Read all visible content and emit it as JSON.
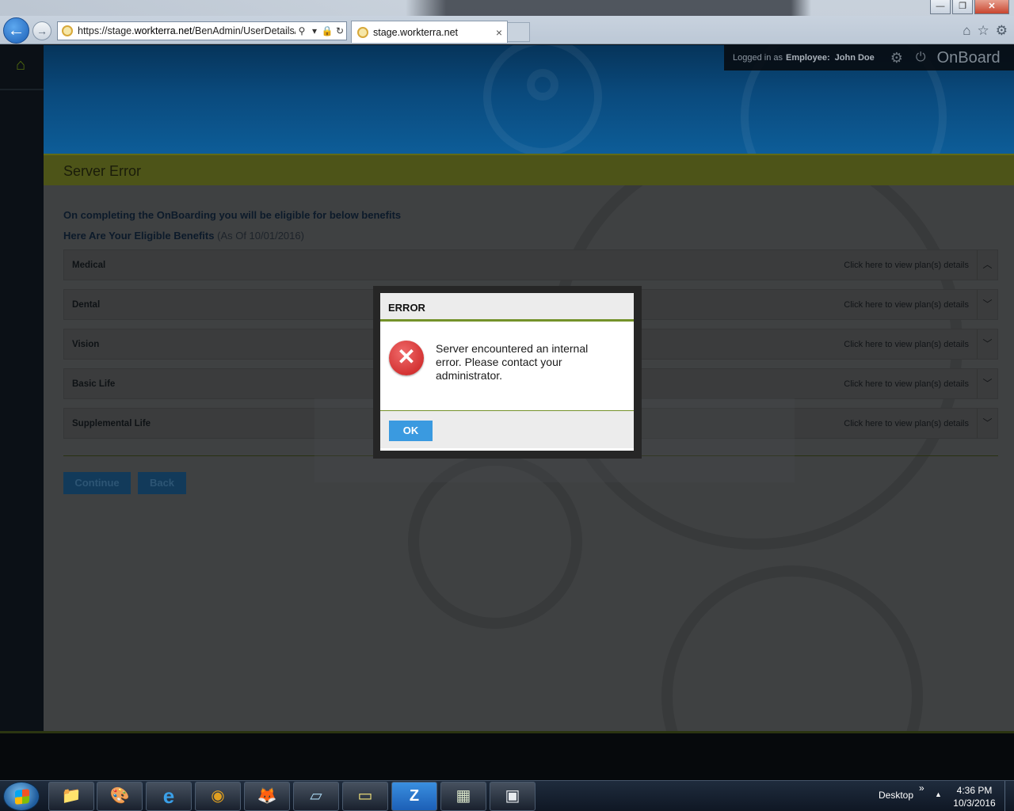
{
  "browser": {
    "url_prefix": "https://stage.",
    "url_domain": "workterra.net",
    "url_path": "/BenAdmin/UserDetails/I",
    "tab_title": "stage.workterra.net",
    "tab_close": "×",
    "win_min": "—",
    "win_max": "❐",
    "win_close": "✕",
    "back_icon": "←",
    "fwd_icon": "→",
    "search_glyph": "⚲",
    "dropdown_glyph": "▾",
    "lock_glyph": "🔒",
    "refresh_glyph": "↻",
    "home_glyph": "⌂",
    "star_glyph": "☆",
    "gear_glyph": "⚙"
  },
  "app": {
    "home_glyph": "⌂",
    "user_prefix": "Logged in as",
    "user_role": "Employee:",
    "user_name": "John Doe",
    "gear_glyph": "⚙",
    "power_glyph": "⏻",
    "brand": "OnBoard",
    "page_title": "Server Error",
    "intro": "On completing the OnBoarding you will be eligible for below benefits",
    "eligible_heading": "Here Are Your Eligible Benefits",
    "eligible_asof": "(As Of 10/01/2016)",
    "benefits": [
      {
        "label": "Medical",
        "link": "Click here to view plan(s) details",
        "toggle": "︿"
      },
      {
        "label": "Dental",
        "link": "Click here to view plan(s) details",
        "toggle": "﹀"
      },
      {
        "label": "Vision",
        "link": "Click here to view plan(s) details",
        "toggle": "﹀"
      },
      {
        "label": "Basic Life",
        "link": "Click here to view plan(s) details",
        "toggle": "﹀"
      },
      {
        "label": "Supplemental Life",
        "link": "Click here to view plan(s) details",
        "toggle": "﹀"
      }
    ],
    "continue_label": "Continue",
    "back_label": "Back"
  },
  "modal": {
    "title": "ERROR",
    "icon_glyph": "✕",
    "message": "Server encountered an internal error. Please contact your administrator.",
    "ok_label": "OK"
  },
  "taskbar": {
    "apps": [
      {
        "name": "file-explorer",
        "glyph": "📁"
      },
      {
        "name": "paint",
        "glyph": "🎨"
      },
      {
        "name": "internet-explorer",
        "glyph": "e"
      },
      {
        "name": "chrome",
        "glyph": "◉"
      },
      {
        "name": "firefox",
        "glyph": "🦊"
      },
      {
        "name": "notepad",
        "glyph": "▱"
      },
      {
        "name": "sticky-notes",
        "glyph": "▭"
      },
      {
        "name": "zoom",
        "glyph": "Z"
      },
      {
        "name": "calculator",
        "glyph": "▦"
      },
      {
        "name": "window-app",
        "glyph": "▣"
      }
    ],
    "desktop_label": "Desktop",
    "chevron": "»",
    "tray_up": "▲",
    "time": "4:36 PM",
    "date": "10/3/2016"
  },
  "colors": {
    "accent_green": "#74922a",
    "ok_blue": "#3a9ae0",
    "error_red": "#c81d1d",
    "banner_blue": "#0a4a7d"
  }
}
